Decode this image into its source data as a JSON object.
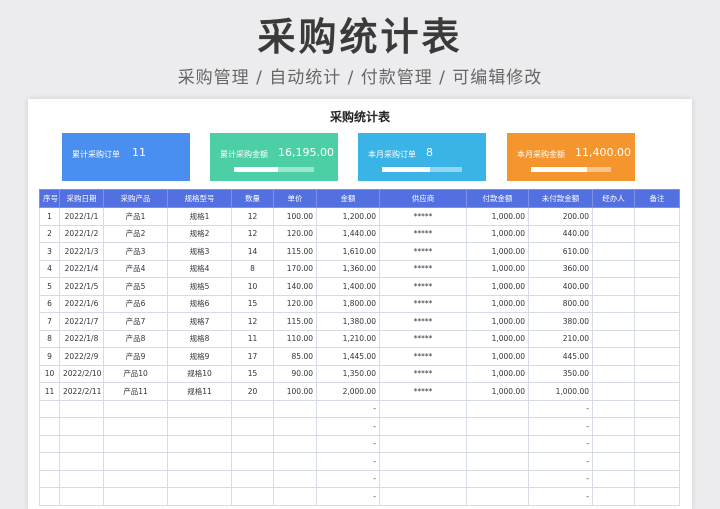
{
  "header": {
    "title": "采购统计表",
    "subtitle": "采购管理 / 自动统计 / 付款管理 / 可编辑修改"
  },
  "sheet": {
    "title": "采购统计表",
    "cards": [
      {
        "label": "累计采购订单",
        "value": "11",
        "color": "#4a8ff0",
        "progress": null
      },
      {
        "label": "累计采购金额",
        "value": "16,195.00",
        "color": "#4ccfa6",
        "progress": 0.55
      },
      {
        "label": "本月采购订单",
        "value": "8",
        "color": "#3ab4e6",
        "progress": 0.6
      },
      {
        "label": "本月采购金额",
        "value": "11,400.00",
        "color": "#f4952e",
        "progress": 0.7
      }
    ],
    "columns": [
      "序号",
      "采购日期",
      "采购产品",
      "规格型号",
      "数量",
      "单价",
      "金额",
      "供应商",
      "付款金额",
      "未付款金额",
      "经办人",
      "备注"
    ],
    "rows": [
      [
        "1",
        "2022/1/1",
        "产品1",
        "规格1",
        "12",
        "100.00",
        "1,200.00",
        "*****",
        "1,000.00",
        "200.00",
        "",
        ""
      ],
      [
        "2",
        "2022/1/2",
        "产品2",
        "规格2",
        "12",
        "120.00",
        "1,440.00",
        "*****",
        "1,000.00",
        "440.00",
        "",
        ""
      ],
      [
        "3",
        "2022/1/3",
        "产品3",
        "规格3",
        "14",
        "115.00",
        "1,610.00",
        "*****",
        "1,000.00",
        "610.00",
        "",
        ""
      ],
      [
        "4",
        "2022/1/4",
        "产品4",
        "规格4",
        "8",
        "170.00",
        "1,360.00",
        "*****",
        "1,000.00",
        "360.00",
        "",
        ""
      ],
      [
        "5",
        "2022/1/5",
        "产品5",
        "规格5",
        "10",
        "140.00",
        "1,400.00",
        "*****",
        "1,000.00",
        "400.00",
        "",
        ""
      ],
      [
        "6",
        "2022/1/6",
        "产品6",
        "规格6",
        "15",
        "120.00",
        "1,800.00",
        "*****",
        "1,000.00",
        "800.00",
        "",
        ""
      ],
      [
        "7",
        "2022/1/7",
        "产品7",
        "规格7",
        "12",
        "115.00",
        "1,380.00",
        "*****",
        "1,000.00",
        "380.00",
        "",
        ""
      ],
      [
        "8",
        "2022/1/8",
        "产品8",
        "规格8",
        "11",
        "110.00",
        "1,210.00",
        "*****",
        "1,000.00",
        "210.00",
        "",
        ""
      ],
      [
        "9",
        "2022/2/9",
        "产品9",
        "规格9",
        "17",
        "85.00",
        "1,445.00",
        "*****",
        "1,000.00",
        "445.00",
        "",
        ""
      ],
      [
        "10",
        "2022/2/10",
        "产品10",
        "规格10",
        "15",
        "90.00",
        "1,350.00",
        "*****",
        "1,000.00",
        "350.00",
        "",
        ""
      ],
      [
        "11",
        "2022/2/11",
        "产品11",
        "规格11",
        "20",
        "100.00",
        "2,000.00",
        "*****",
        "1,000.00",
        "1,000.00",
        "",
        ""
      ],
      [
        "",
        "",
        "",
        "",
        "",
        "",
        "-",
        "",
        "",
        "-",
        "",
        ""
      ],
      [
        "",
        "",
        "",
        "",
        "",
        "",
        "-",
        "",
        "",
        "-",
        "",
        ""
      ],
      [
        "",
        "",
        "",
        "",
        "",
        "",
        "-",
        "",
        "",
        "-",
        "",
        ""
      ],
      [
        "",
        "",
        "",
        "",
        "",
        "",
        "-",
        "",
        "",
        "-",
        "",
        ""
      ],
      [
        "",
        "",
        "",
        "",
        "",
        "",
        "-",
        "",
        "",
        "-",
        "",
        ""
      ],
      [
        "",
        "",
        "",
        "",
        "",
        "",
        "-",
        "",
        "",
        "-",
        "",
        ""
      ]
    ]
  }
}
